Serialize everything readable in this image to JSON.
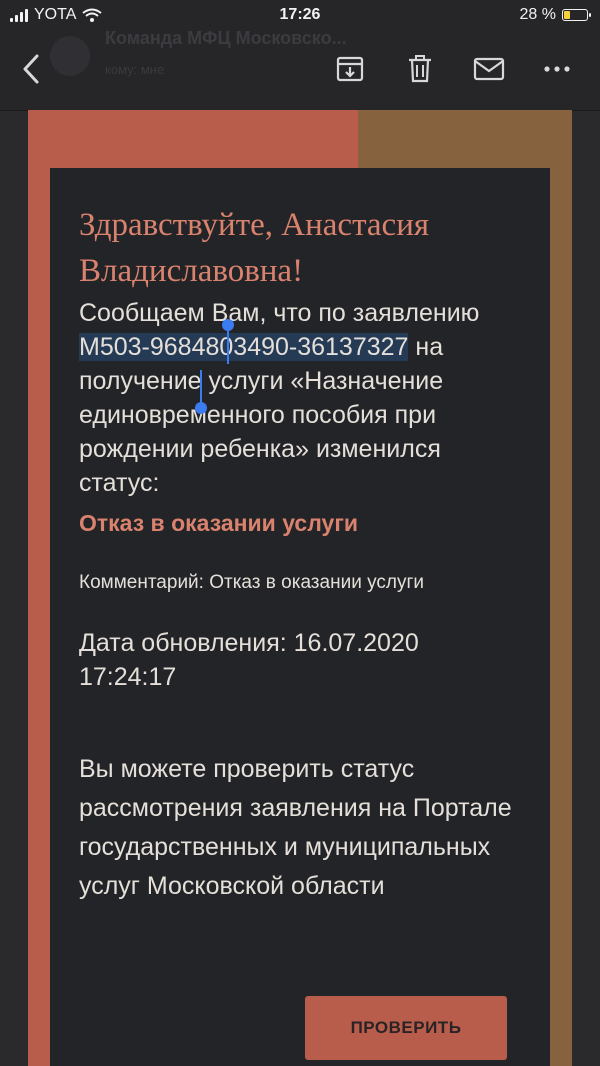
{
  "status_bar": {
    "carrier": "YOTA",
    "time": "17:26",
    "battery": "28 %",
    "battery_level": 0.28
  },
  "toolbar": {
    "sender_ghost": "Команда МФЦ Московско...",
    "sub_ghost": "кому: мне",
    "icons": [
      "back-icon",
      "archive-icon",
      "trash-icon",
      "mail-icon",
      "more-icon"
    ]
  },
  "email": {
    "greeting": "Здравствуйте, Анастасия Владиславовна!",
    "intro_before": "Сообщаем Вам, что по заявлению ",
    "application_number": "M503-9684803490-36137327",
    "intro_after": " на получение услуги «Назначение единовременного пособия при рождении ребенка» изменился статус:",
    "status": "Отказ в оказании услуги",
    "comment": "Комментарий: Отказ в оказании услуги",
    "date": "Дата обновления: 16.07.2020 17:24:17",
    "info": "Вы можете проверить статус рассмотрения заявления на Портале государственных и муниципальных услуг Московской области",
    "button_label": "ПРОВЕРИТЬ"
  },
  "colors": {
    "accent": "#d9826e",
    "button": "#b85d4c",
    "stripe_left": "#b85d4c",
    "stripe_right": "#87623f",
    "selection": "#253a55",
    "handle": "#3b7cf0"
  }
}
